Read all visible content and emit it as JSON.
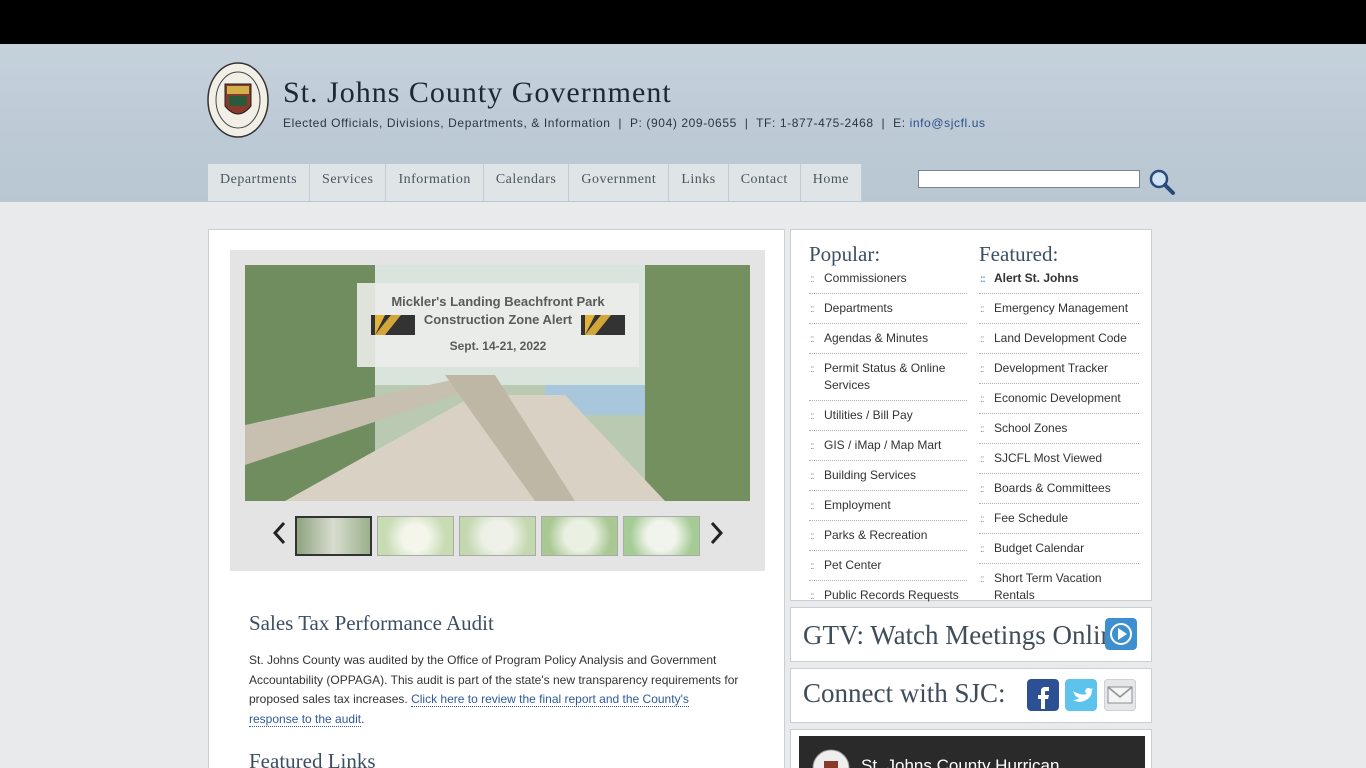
{
  "header": {
    "title": "St. Johns County Government",
    "subline": "Elected Officials, Divisions, Departments, & Information  |  P: (904) 209-0655  |  TF: 1-877-475-2468  |  E: ",
    "email": "info@sjcfl.us",
    "seal_text": "ST. JOHNS COUNTY FLORIDA"
  },
  "nav": {
    "items": [
      "Departments",
      "Services",
      "Information",
      "Calendars",
      "Government",
      "Links",
      "Contact",
      "Home"
    ]
  },
  "search": {
    "placeholder": ""
  },
  "slideshow": {
    "title_line1": "Mickler's Landing Beachfront Park",
    "title_line2": "Construction Zone Alert",
    "dates": "Sept. 14-21, 2022",
    "thumb_count": 5,
    "active_thumb": 1
  },
  "main": {
    "section_title": "Sales Tax Performance Audit",
    "body": "St. Johns County was audited by the Office of Program Policy Analysis and Government Accountability (OPPAGA). This audit is part of the state's new transparency requirements for proposed sales tax increases. ",
    "link": "Click here to review the final report and the County's response to the audit",
    "body_end": ".",
    "featured_links_title": "Featured Links"
  },
  "popular": {
    "title": "Popular:",
    "items": [
      "Commissioners",
      "Departments",
      "Agendas & Minutes",
      "Permit Status & Online Services",
      "Utilities / Bill Pay",
      "GIS / iMap / Map Mart",
      "Building Services",
      "Employment",
      "Parks & Recreation",
      "Pet Center",
      "Public Records Requests"
    ]
  },
  "featured": {
    "title": "Featured:",
    "items": [
      "Alert St. Johns",
      "Emergency Management",
      "Land Development Code",
      "Development Tracker",
      "Economic Development",
      "School Zones",
      "SJCFL Most Viewed",
      "Boards & Committees",
      "Fee Schedule",
      "Budget Calendar",
      "Short Term Vacation Rentals"
    ]
  },
  "gtv": {
    "title": "GTV: Watch Meetings Online"
  },
  "connect": {
    "title": "Connect with SJC:"
  },
  "video": {
    "title": "St. Johns County Hurrican"
  },
  "colors": {
    "accent": "#3b4f63",
    "link": "#2d5a9a",
    "header_bg": "#bfcbd6"
  }
}
